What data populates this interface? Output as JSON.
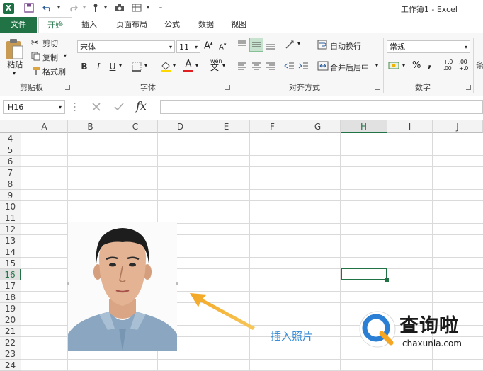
{
  "window": {
    "title": "工作簿1 - Excel"
  },
  "ribbon_tabs": [
    "文件",
    "开始",
    "插入",
    "页面布局",
    "公式",
    "数据",
    "视图"
  ],
  "clipboard": {
    "paste": "粘贴",
    "cut": "剪切",
    "copy": "复制",
    "format_painter": "格式刷",
    "group": "剪贴板"
  },
  "font": {
    "name": "宋体",
    "size": "11",
    "bold": "B",
    "italic": "I",
    "underline": "U",
    "grow": "A",
    "shrink": "A",
    "phonetic": "wén",
    "color_letter": "A",
    "group": "字体"
  },
  "alignment": {
    "wrap_text": "自动换行",
    "merge_center": "合并后居中",
    "group": "对齐方式"
  },
  "number": {
    "format": "常规",
    "group": "数字",
    "percent": "%",
    "comma": ",",
    "inc_decimal": "+.0 .00",
    "dec_decimal": ".00 +.0"
  },
  "formula_bar": {
    "name_box": "H16",
    "fx": "fx"
  },
  "sheet": {
    "columns": [
      "A",
      "B",
      "C",
      "D",
      "E",
      "F",
      "G",
      "H",
      "I",
      "J"
    ],
    "rows": [
      "4",
      "5",
      "6",
      "7",
      "8",
      "9",
      "10",
      "11",
      "12",
      "13",
      "14",
      "15",
      "16",
      "17",
      "18",
      "19",
      "20",
      "21",
      "22",
      "23",
      "24"
    ],
    "selected_column": "H",
    "selected_row": "16"
  },
  "annotation": {
    "text": "插入照片",
    "color": "#3b8ed8"
  },
  "watermark": {
    "text": "查询啦",
    "url": "chaxunla.com"
  },
  "colors": {
    "accent": "#217346",
    "watermark_blue": "#2a7fd4",
    "watermark_orange": "#f5a623"
  }
}
